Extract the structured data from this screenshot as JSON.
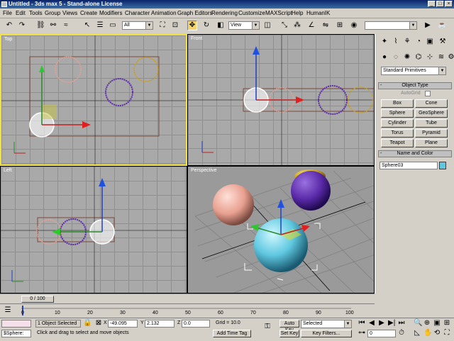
{
  "window": {
    "title": "Untitled - 3ds max 5 - Stand-alone License",
    "buttons": [
      "_",
      "□",
      "×"
    ]
  },
  "menu": [
    "File",
    "Edit",
    "Tools",
    "Group",
    "Views",
    "Create",
    "Modifiers",
    "Character",
    "Animation",
    "Graph Editors",
    "Rendering",
    "Customize",
    "MAXScript",
    "Help",
    "HumanIK"
  ],
  "toolbar": {
    "selection_filter": "All",
    "ref_coord": "View",
    "named_selection": ""
  },
  "viewports": {
    "top": "Top",
    "front": "Front",
    "left": "Left",
    "perspective": "Perspective"
  },
  "command_panel": {
    "category": "Standard Primitives",
    "object_type_title": "Object Type",
    "autogrid": "AutoGrid",
    "buttons": [
      "Box",
      "Cone",
      "Sphere",
      "GeoSphere",
      "Cylinder",
      "Tube",
      "Torus",
      "Pyramid",
      "Teapot",
      "Plane"
    ],
    "name_color_title": "Name and Color",
    "object_name": "Sphere03",
    "object_color": "#5fc8e0"
  },
  "timeline": {
    "frame_display": "0 / 100",
    "ticks": [
      "0",
      "10",
      "20",
      "30",
      "40",
      "50",
      "60",
      "70",
      "80",
      "90",
      "100"
    ]
  },
  "status": {
    "maxscript_listener": "$Sphere:",
    "selection_count": "1 Object Selected",
    "prompt": "Click and drag to select and move objects",
    "x_label": "X",
    "x_value": "-49.095",
    "y_label": "Y",
    "y_value": "2.132",
    "z_label": "Z",
    "z_value": "0.0",
    "grid": "Grid = 10.0",
    "add_time_tag": "Add Time Tag",
    "auto_key": "Auto Key",
    "set_key": "Set Key",
    "key_mode": "Selected",
    "key_filters": "Key Filters...",
    "current_frame": "0"
  },
  "colors": {
    "active_viewport": "#f0e040",
    "sphere_pink": "#e8a090",
    "sphere_purple": "#5a2aa8",
    "sphere_gold": "#c8a020",
    "sphere_cyan": "#5fc8e0",
    "sphere_white": "#ffffff"
  }
}
